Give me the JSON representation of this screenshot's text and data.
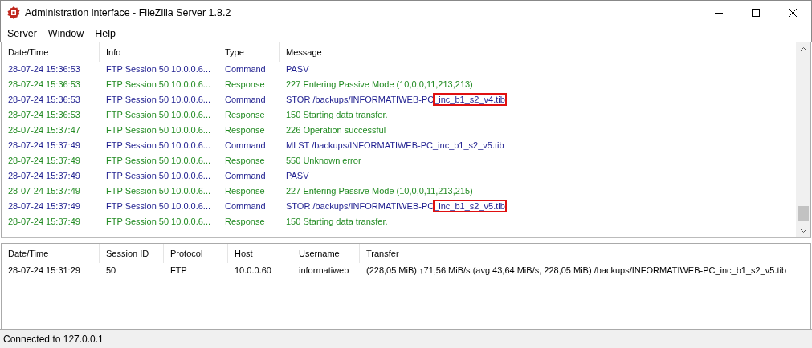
{
  "window": {
    "title": "Administration interface - FileZilla Server 1.8.2"
  },
  "menu": [
    "Server",
    "Window",
    "Help"
  ],
  "log": {
    "columns": [
      "Date/Time",
      "Info",
      "Type",
      "Message"
    ],
    "rows": [
      {
        "kind": "command",
        "time": "28-07-24 15:36:53",
        "info": "FTP Session 50 10.0.0.6...",
        "type": "Command",
        "message": "PASV"
      },
      {
        "kind": "response",
        "time": "28-07-24 15:36:53",
        "info": "FTP Session 50 10.0.0.6...",
        "type": "Response",
        "message": "227 Entering Passive Mode (10,0,0,11,213,213)"
      },
      {
        "kind": "command",
        "time": "28-07-24 15:36:53",
        "info": "FTP Session 50 10.0.0.6...",
        "type": "Command",
        "message": "STOR /backups/INFORMATIWEB-PC",
        "highlighted": "_inc_b1_s2_v4.tib"
      },
      {
        "kind": "response",
        "time": "28-07-24 15:36:53",
        "info": "FTP Session 50 10.0.0.6...",
        "type": "Response",
        "message": "150 Starting data transfer."
      },
      {
        "kind": "response",
        "time": "28-07-24 15:37:47",
        "info": "FTP Session 50 10.0.0.6...",
        "type": "Response",
        "message": "226 Operation successful"
      },
      {
        "kind": "command",
        "time": "28-07-24 15:37:49",
        "info": "FTP Session 50 10.0.0.6...",
        "type": "Command",
        "message": "MLST /backups/INFORMATIWEB-PC_inc_b1_s2_v5.tib"
      },
      {
        "kind": "response",
        "time": "28-07-24 15:37:49",
        "info": "FTP Session 50 10.0.0.6...",
        "type": "Response",
        "message": "550 Unknown error"
      },
      {
        "kind": "command",
        "time": "28-07-24 15:37:49",
        "info": "FTP Session 50 10.0.0.6...",
        "type": "Command",
        "message": "PASV"
      },
      {
        "kind": "response",
        "time": "28-07-24 15:37:49",
        "info": "FTP Session 50 10.0.0.6...",
        "type": "Response",
        "message": "227 Entering Passive Mode (10,0,0,11,213,215)"
      },
      {
        "kind": "command",
        "time": "28-07-24 15:37:49",
        "info": "FTP Session 50 10.0.0.6...",
        "type": "Command",
        "message": "STOR /backups/INFORMATIWEB-PC",
        "highlighted": "_inc_b1_s2_v5.tib"
      },
      {
        "kind": "response",
        "time": "28-07-24 15:37:49",
        "info": "FTP Session 50 10.0.0.6...",
        "type": "Response",
        "message": "150 Starting data transfer."
      }
    ]
  },
  "sessions": {
    "columns": [
      "Date/Time",
      "Session ID",
      "Protocol",
      "Host",
      "Username",
      "Transfer"
    ],
    "rows": [
      [
        "28-07-24 15:31:29",
        "50",
        "FTP",
        "10.0.0.60",
        "informatiweb",
        "(228,05 MiB) ↑71,56 MiB/s (avg 43,64 MiB/s, 228,05 MiB) /backups/INFORMATIWEB-PC_inc_b1_s2_v5.tib"
      ]
    ]
  },
  "status_bar": "Connected to 127.0.0.1"
}
